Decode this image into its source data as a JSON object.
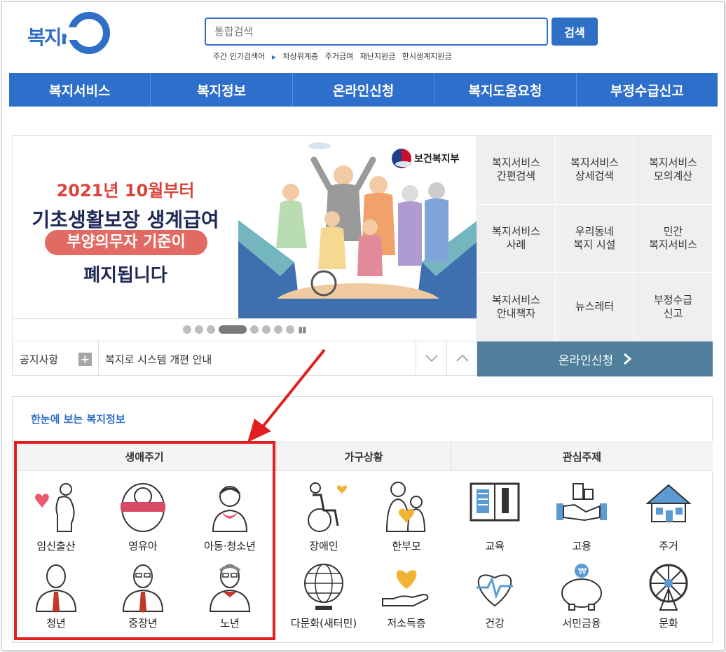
{
  "header": {
    "logo_text": "복지ro",
    "search_placeholder": "통합검색",
    "search_button": "검색",
    "popular_label": "주간 인기검색어",
    "popular_keywords": [
      "차상위계층",
      "주거급여",
      "재난지원금",
      "한시생계지원금"
    ]
  },
  "nav": {
    "items": [
      "복지서비스",
      "복지정보",
      "온라인신청",
      "복지도움요청",
      "부정수급신고"
    ]
  },
  "banner": {
    "line1": "2021년 10월부터",
    "line2": "기초생활보장 생계급여",
    "line3": "부양의무자 기준이",
    "line4": "폐지됩니다",
    "ministry": "보건복지부"
  },
  "notice": {
    "label": "공지사항",
    "text": "복지로 시스템 개편 안내"
  },
  "service_grid": {
    "items": [
      "복지서비스\n간편검색",
      "복지서비스\n상세검색",
      "복지서비스\n모의계산",
      "복지서비스\n사례",
      "우리동네\n복지 시설",
      "민간\n복지서비스",
      "복지서비스\n안내책자",
      "뉴스레터",
      "부정수급\n신고"
    ],
    "online_label": "온라인신청"
  },
  "welfare_info": {
    "title": "한눈에 보는 복지정보",
    "columns": [
      "생애주기",
      "가구상황",
      "관심주제"
    ],
    "life_cycle": [
      "임신출산",
      "영유아",
      "아동·청소년",
      "청년",
      "중장년",
      "노년"
    ],
    "household": [
      "장애인",
      "한부모",
      "다문화(새터민)",
      "저소득층"
    ],
    "topics": [
      "교육",
      "고용",
      "주거",
      "건강",
      "서민금융",
      "문화"
    ]
  },
  "colors": {
    "primary": "#2e6fcc",
    "online": "#4f7f9b",
    "highlight": "#e02020"
  }
}
